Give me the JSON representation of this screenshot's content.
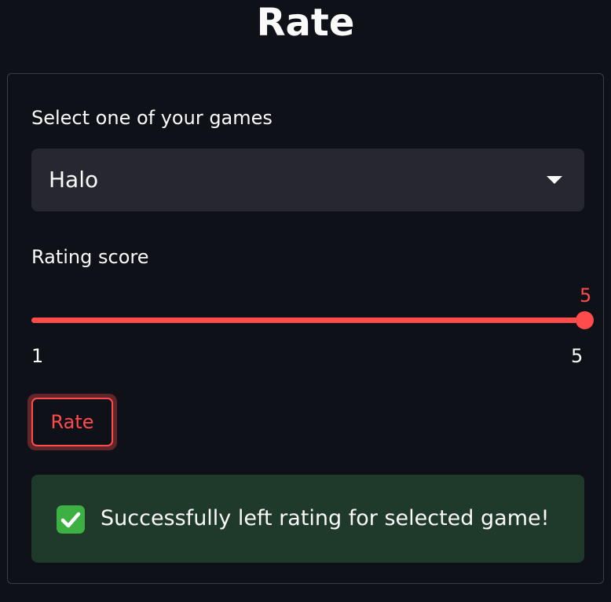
{
  "page": {
    "title": "Rate"
  },
  "form": {
    "game_select": {
      "label": "Select one of your games",
      "value": "Halo",
      "icon": "chevron-down-icon"
    },
    "rating_slider": {
      "label": "Rating score",
      "value": 5,
      "value_label": "5",
      "min": 1,
      "max": 5,
      "min_label": "1",
      "max_label": "5",
      "accent": "#ff4b4b"
    },
    "submit_button": {
      "label": "Rate"
    }
  },
  "alert": {
    "icon": "check-mark-icon",
    "message": "Successfully left rating for selected game!",
    "color": "#1f3a2b"
  }
}
